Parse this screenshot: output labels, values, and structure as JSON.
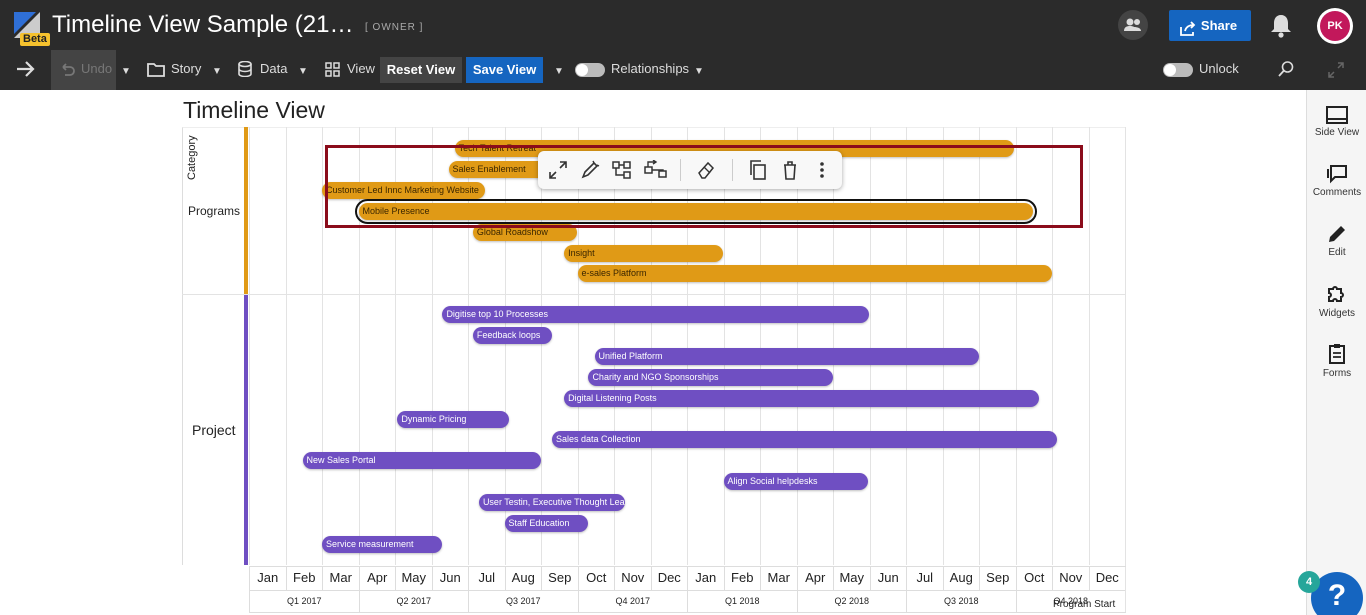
{
  "app": {
    "title": "Timeline View Sample (21…",
    "beta": "Beta",
    "role": "[ OWNER ]",
    "share": "Share",
    "avatar": "PK",
    "help_count": "4"
  },
  "toolbar": {
    "undo": "Undo",
    "story": "Story",
    "data": "Data",
    "view": "View",
    "reset_view": "Reset View",
    "save_view": "Save View",
    "relationships": "Relationships",
    "unlock": "Unlock"
  },
  "side_panel": {
    "items": [
      "Side View",
      "Comments",
      "Edit",
      "Widgets",
      "Forms"
    ]
  },
  "chart": {
    "title": "Timeline View",
    "category_label": "Category",
    "program_start": "Program Start"
  },
  "colors": {
    "programs": "#e09a16",
    "projects": "#6f4fc2",
    "accent": "#1565c0"
  },
  "chart_data": {
    "type": "gantt",
    "x_range": [
      "2017-01",
      "2018-12"
    ],
    "months": [
      "Jan",
      "Feb",
      "Mar",
      "Apr",
      "May",
      "Jun",
      "Jul",
      "Aug",
      "Sep",
      "Oct",
      "Nov",
      "Dec",
      "Jan",
      "Feb",
      "Mar",
      "Apr",
      "May",
      "Jun",
      "Jul",
      "Aug",
      "Sep",
      "Oct",
      "Nov",
      "Dec"
    ],
    "quarters": [
      "Q1 2017",
      "Q2 2017",
      "Q3 2017",
      "Q4 2017",
      "Q1 2018",
      "Q2 2018",
      "Q3 2018",
      "Q4 2018"
    ],
    "lanes": [
      {
        "name": "Programs",
        "items": [
          {
            "label": "Tech Talent Retreat",
            "start": "2017-06-20",
            "end": "2018-09-30"
          },
          {
            "label": "Sales Enablement",
            "start": "2017-06-15",
            "end": "2017-09-25"
          },
          {
            "label": "Customer Led Innc Marketing Website",
            "start": "2017-03-01",
            "end": "2017-07-15"
          },
          {
            "label": "Mobile Presence",
            "start": "2017-04-01",
            "end": "2018-10-15"
          },
          {
            "label": "Global Roadshow",
            "start": "2017-07-05",
            "end": "2017-10-01"
          },
          {
            "label": "Insight",
            "start": "2017-09-20",
            "end": "2018-02-01"
          },
          {
            "label": "e-sales Platform",
            "start": "2017-10-01",
            "end": "2018-11-01"
          }
        ]
      },
      {
        "name": "Project",
        "items": [
          {
            "label": "Digitise top 10 Processes",
            "start": "2017-06-10",
            "end": "2018-06-01"
          },
          {
            "label": "Feedback loops",
            "start": "2017-07-05",
            "end": "2017-09-10"
          },
          {
            "label": "Unified Platform",
            "start": "2017-10-15",
            "end": "2018-09-01"
          },
          {
            "label": "Charity and NGO Sponsorships",
            "start": "2017-10-10",
            "end": "2018-05-01"
          },
          {
            "label": "Digital Listening Posts",
            "start": "2017-09-20",
            "end": "2018-10-20"
          },
          {
            "label": "Dynamic Pricing",
            "start": "2017-05-03",
            "end": "2017-08-05"
          },
          {
            "label": "Sales data Collection",
            "start": "2017-09-10",
            "end": "2018-11-05"
          },
          {
            "label": "New Sales Portal",
            "start": "2017-02-15",
            "end": "2017-09-01"
          },
          {
            "label": "Align Social helpdesks",
            "start": "2018-02-01",
            "end": "2018-05-30"
          },
          {
            "label": "User Testin, Executive Thought Leaders",
            "start": "2017-07-10",
            "end": "2017-11-10"
          },
          {
            "label": "Staff Education",
            "start": "2017-08-01",
            "end": "2017-10-10"
          },
          {
            "label": "Service measurement",
            "start": "2017-03-01",
            "end": "2017-06-10"
          }
        ]
      }
    ]
  }
}
